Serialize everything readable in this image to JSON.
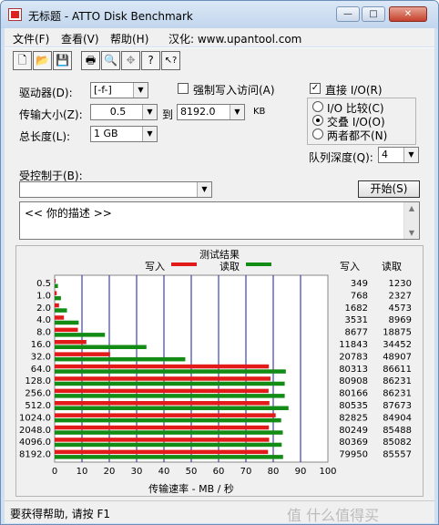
{
  "window": {
    "title": "无标题 - ATTO Disk Benchmark",
    "minimize_glyph": "—",
    "maximize_glyph": "□",
    "close_glyph": "✕"
  },
  "menu": {
    "items": [
      "文件(F)",
      "查看(V)",
      "帮助(H)",
      "汉化: www.upantool.com"
    ]
  },
  "toolbar": {
    "icons": [
      "new-icon",
      "open-icon",
      "save-icon",
      "print-icon",
      "print-preview-icon",
      "move-icon",
      "help-icon",
      "context-help-icon"
    ],
    "glyphs": [
      "🗋",
      "📂",
      "💾",
      "🖶",
      "🔍",
      "✥",
      "?",
      "↖?"
    ]
  },
  "settings": {
    "drive_label": "驱动器(D):",
    "drive_value": "[-f-]",
    "transfer_label": "传输大小(Z):",
    "transfer_from": "0.5",
    "to_label": "到",
    "transfer_to": "8192.0",
    "unit": "KB",
    "total_label": "总长度(L):",
    "total_value": "1 GB",
    "force_write_label": "强制写入访问(A)",
    "direct_io_label": "直接 I/O(R)",
    "direct_io_checked": true,
    "io_compare_label": "I/O 比较(C)",
    "overlapped_label": "交叠 I/O(O)",
    "neither_label": "两者都不(N)",
    "queue_label": "队列深度(Q):",
    "queue_value": "4",
    "controlled_label": "受控制于(B):",
    "controlled_value": "",
    "start_label": "开始(S)",
    "description": "<<  你的描述    >>"
  },
  "results": {
    "title": "测试结果",
    "write_legend": "写入",
    "read_legend": "读取",
    "col_write": "写入",
    "col_read": "读取",
    "write_color": "#e31a1a",
    "read_color": "#128c14"
  },
  "chart_data": {
    "type": "bar",
    "orientation": "horizontal",
    "title": "测试结果",
    "xlabel": "传输速率 - MB / 秒",
    "xlim": [
      0,
      100
    ],
    "xticks": [
      0,
      10,
      20,
      30,
      40,
      50,
      60,
      70,
      80,
      90,
      100
    ],
    "categories": [
      "0.5",
      "1.0",
      "2.0",
      "4.0",
      "8.0",
      "16.0",
      "32.0",
      "64.0",
      "128.0",
      "256.0",
      "512.0",
      "1024.0",
      "2048.0",
      "4096.0",
      "8192.0"
    ],
    "series": [
      {
        "name": "写入",
        "values": [
          0.34,
          0.75,
          1.6,
          3.4,
          8.5,
          11.6,
          20.3,
          78.4,
          79.0,
          78.3,
          78.6,
          80.9,
          78.4,
          78.5,
          78.1
        ]
      },
      {
        "name": "读取",
        "values": [
          1.2,
          2.3,
          4.5,
          8.8,
          18.4,
          33.6,
          47.8,
          84.6,
          84.2,
          84.2,
          85.6,
          82.9,
          83.5,
          83.1,
          83.6
        ]
      }
    ],
    "write_numbers": [
      "349",
      "768",
      "1682",
      "3531",
      "8677",
      "11843",
      "20783",
      "80313",
      "80908",
      "80166",
      "80535",
      "82825",
      "80249",
      "80369",
      "79950"
    ],
    "read_numbers": [
      "1230",
      "2327",
      "4573",
      "8969",
      "18875",
      "34452",
      "48907",
      "86611",
      "86231",
      "86231",
      "87673",
      "84904",
      "85488",
      "85082",
      "85557"
    ],
    "grid": true
  },
  "status": {
    "text": "要获得帮助, 请按 F1",
    "watermark": "值 什么值得买"
  }
}
